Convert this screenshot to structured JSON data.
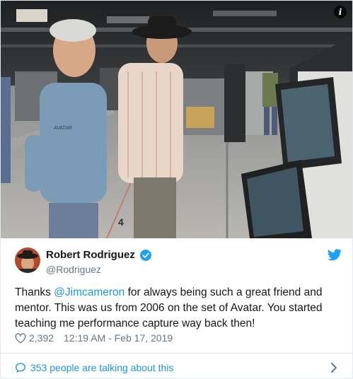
{
  "tweet": {
    "display_name": "Robert Rodriguez",
    "handle": "@Rodriguez",
    "text_before": "Thanks ",
    "mention": "@Jimcameron",
    "text_after": " for always being such a great friend and mentor. This was us from 2006 on the set of Avatar. You started teaching me performance capture way back then!",
    "likes": "2,392",
    "timestamp": "12:19 AM - Feb 17, 2019",
    "conversation": "353 people are talking about this"
  },
  "photo": {
    "shirt_text": "AVATAR",
    "floor_number": "4"
  },
  "icons": {
    "info": "info-icon",
    "verified": "verified-badge-icon",
    "brand": "twitter-bird-icon",
    "like": "heart-icon",
    "reply": "speech-bubble-icon",
    "more": "chevron-right-icon"
  },
  "colors": {
    "accent": "#1b95e0",
    "text": "#14171a",
    "muted": "#657786",
    "border": "#e1e8ed"
  }
}
